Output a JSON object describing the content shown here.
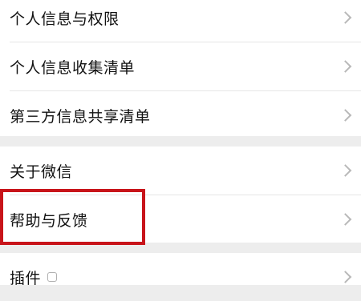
{
  "settings": {
    "group1": [
      {
        "label": "个人信息与权限"
      },
      {
        "label": "个人信息收集清单"
      },
      {
        "label": "第三方信息共享清单"
      }
    ],
    "group2": [
      {
        "label": "关于微信"
      },
      {
        "label": "帮助与反馈"
      }
    ],
    "group3": [
      {
        "label": "插件"
      }
    ]
  },
  "colors": {
    "highlight": "#c8141a",
    "background": "#ededed"
  },
  "icons": {
    "chevron": "chevron-right-icon",
    "plugin_badge": "plugin-badge-icon"
  }
}
